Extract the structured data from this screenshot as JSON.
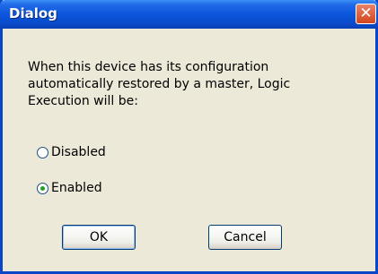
{
  "window": {
    "title": "Dialog",
    "close_glyph": "✕"
  },
  "message": "When this device has its configuration automatically restored by a master, Logic Execution will be:",
  "options": [
    {
      "label": "Disabled",
      "selected": false
    },
    {
      "label": "Enabled",
      "selected": true
    }
  ],
  "buttons": {
    "ok": "OK",
    "cancel": "Cancel"
  },
  "colors": {
    "title_bar": "#0b55dd",
    "dialog_bg": "#ece9d8",
    "close_button": "#d2451b",
    "radio_dot": "#21a121"
  }
}
